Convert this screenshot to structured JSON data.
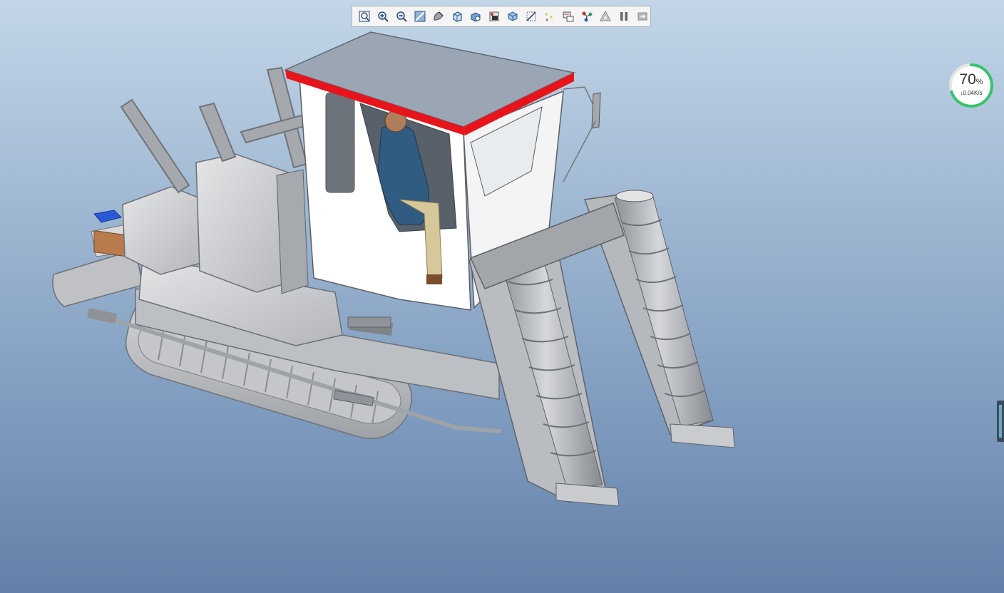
{
  "window": {
    "background_top": "#c3d6e8",
    "background_bottom": "#6480a8"
  },
  "toolbar": {
    "buttons": [
      {
        "name": "zoom-fit-icon"
      },
      {
        "name": "zoom-in-icon"
      },
      {
        "name": "zoom-out-icon"
      },
      {
        "name": "refit-view-icon"
      },
      {
        "name": "shading-icon"
      },
      {
        "name": "saved-views-icon"
      },
      {
        "name": "view-manager-icon"
      },
      {
        "name": "display-style-icon"
      },
      {
        "name": "datum-planes-icon"
      },
      {
        "name": "datum-axes-icon"
      },
      {
        "name": "datum-points-icon"
      },
      {
        "name": "coordinate-systems-icon"
      },
      {
        "name": "annotations-icon"
      },
      {
        "name": "spin-center-icon"
      },
      {
        "name": "warning-icon"
      },
      {
        "name": "pause-icon"
      },
      {
        "name": "regenerate-icon"
      }
    ]
  },
  "network_widget": {
    "percent": "70",
    "percent_unit": "%",
    "rate": "0.04K/s",
    "ring_color": "#35c46a"
  },
  "model": {
    "roof_accent": "#e8141b",
    "body_color": "#c8c9cc",
    "cab_color": "#ffffff",
    "seat_color": "#1f4d6e"
  }
}
